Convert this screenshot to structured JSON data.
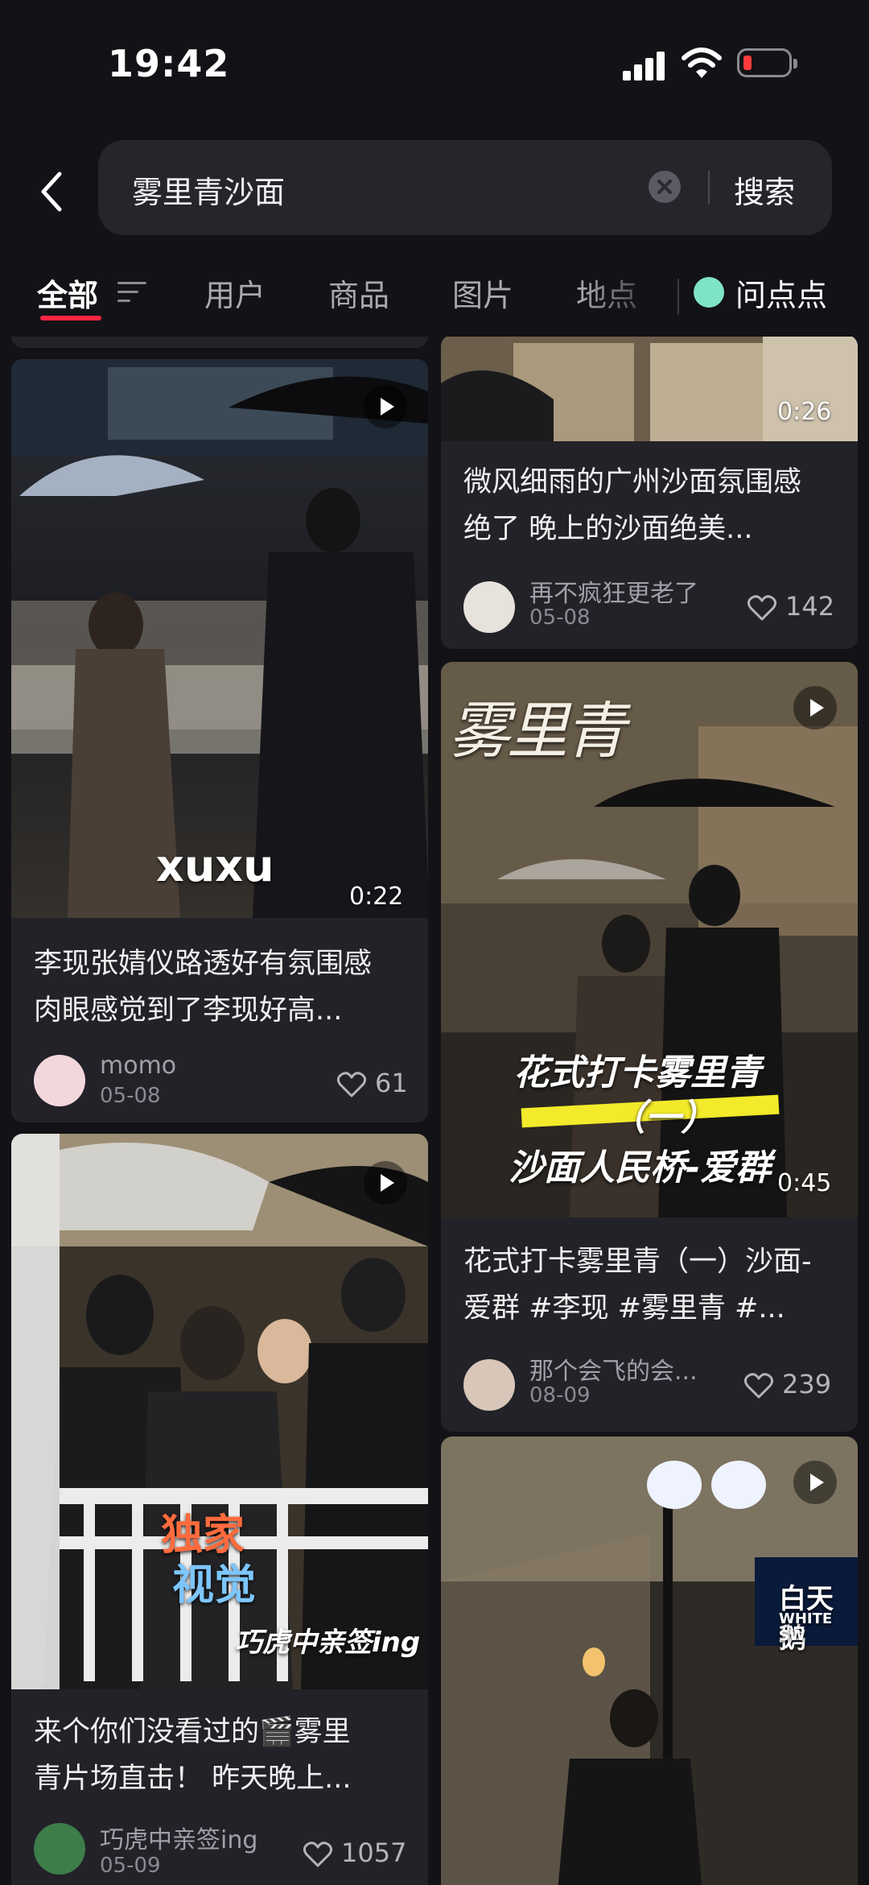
{
  "status_bar": {
    "time": "19:42",
    "signal_icon": "signal-icon",
    "wifi_icon": "wifi-icon",
    "battery_icon": "battery-low-icon",
    "battery_color": "#ff3b3b"
  },
  "search": {
    "query": "雾里青沙面",
    "submit_label": "搜索",
    "back_icon": "chevron-left-icon",
    "clear_icon": "clear-icon"
  },
  "tabs": [
    {
      "label": "全部",
      "active": true
    },
    {
      "label": "用户",
      "active": false
    },
    {
      "label": "商品",
      "active": false
    },
    {
      "label": "图片",
      "active": false
    },
    {
      "label": "地点",
      "active": false
    },
    {
      "label": "问点点",
      "active": false
    }
  ],
  "accent_color": "#ff2442",
  "cards": [
    {
      "title_lines": [
        "李现张婧仪路透好有氛围感",
        "肉眼感觉到了李现好高..."
      ],
      "author": "momo",
      "date": "05-08",
      "likes": "61",
      "duration": "0:22",
      "overlay_text": "xuxu"
    },
    {
      "title_lines": [
        "来个你们没看过的🎬雾里",
        "青片场直击！ 昨天晚上..."
      ],
      "author": "巧虎中亲签ing",
      "date": "05-09",
      "likes": "1057",
      "overlay_lines": [
        "独家",
        "视觉",
        "巧虎中亲签ing"
      ]
    },
    {
      "title_lines": [
        "微风细雨的广州沙面氛围感",
        "绝了 晚上的沙面绝美..."
      ],
      "author": "再不疯狂更老了",
      "date": "05-08",
      "likes": "142",
      "duration": "0:26"
    },
    {
      "title_lines": [
        "花式打卡雾里青（一）沙面-",
        "爱群 #李现 #雾里青 #..."
      ],
      "author": "那个会飞的会...",
      "date": "08-09",
      "likes": "239",
      "duration": "0:45",
      "overlay_lines": [
        "雾里青",
        "花式打卡雾里青",
        "（一）",
        "沙面人民桥-爱群"
      ]
    },
    {
      "overlay_lines": [
        "白天鹅",
        "WHITE SW"
      ]
    }
  ]
}
